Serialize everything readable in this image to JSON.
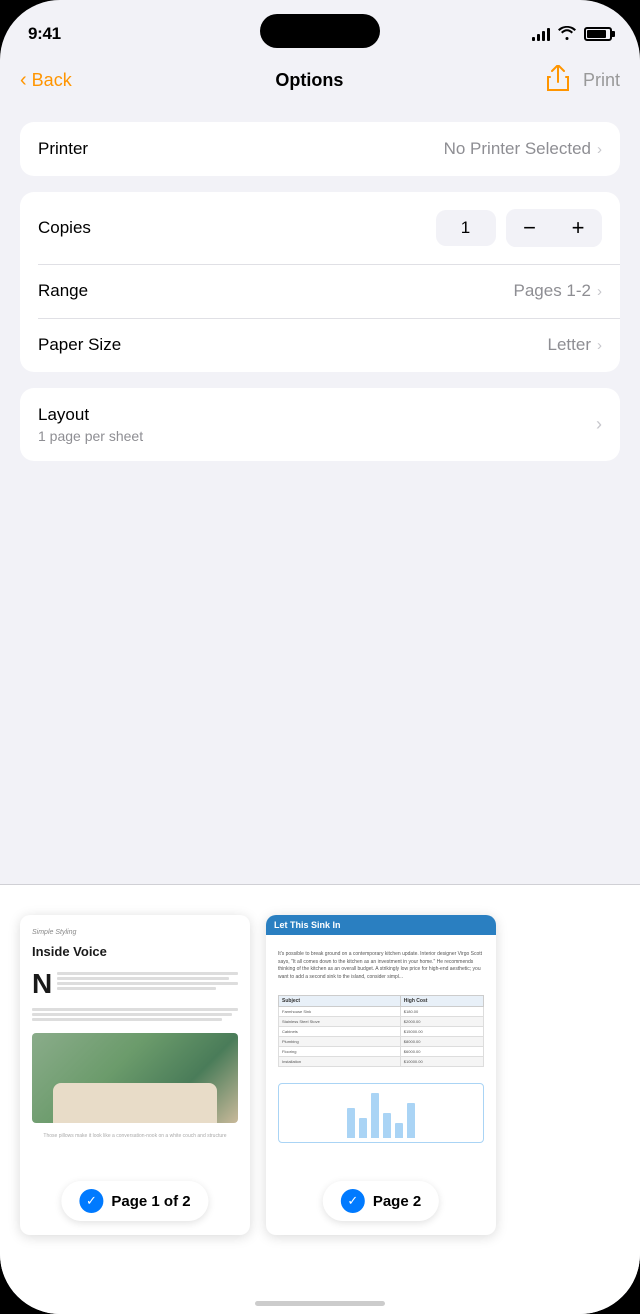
{
  "status_bar": {
    "time": "9:41"
  },
  "nav": {
    "back_label": "Back",
    "title": "Options",
    "print_label": "Print",
    "print_disabled": true
  },
  "printer_section": {
    "label": "Printer",
    "value": "No Printer Selected"
  },
  "settings_section": {
    "copies": {
      "label": "Copies",
      "value": "1"
    },
    "range": {
      "label": "Range",
      "value": "Pages 1-2"
    },
    "paper_size": {
      "label": "Paper Size",
      "value": "Letter"
    }
  },
  "layout_section": {
    "title": "Layout",
    "subtitle": "1 page per sheet"
  },
  "preview": {
    "page1": {
      "subtitle": "Simple Styling",
      "title": "Inside Voice",
      "indicator_label": "Page 1 of 2"
    },
    "page2": {
      "header": "Let This Sink In",
      "indicator_label": "Page 2"
    }
  },
  "stepper": {
    "minus": "−",
    "plus": "+"
  }
}
